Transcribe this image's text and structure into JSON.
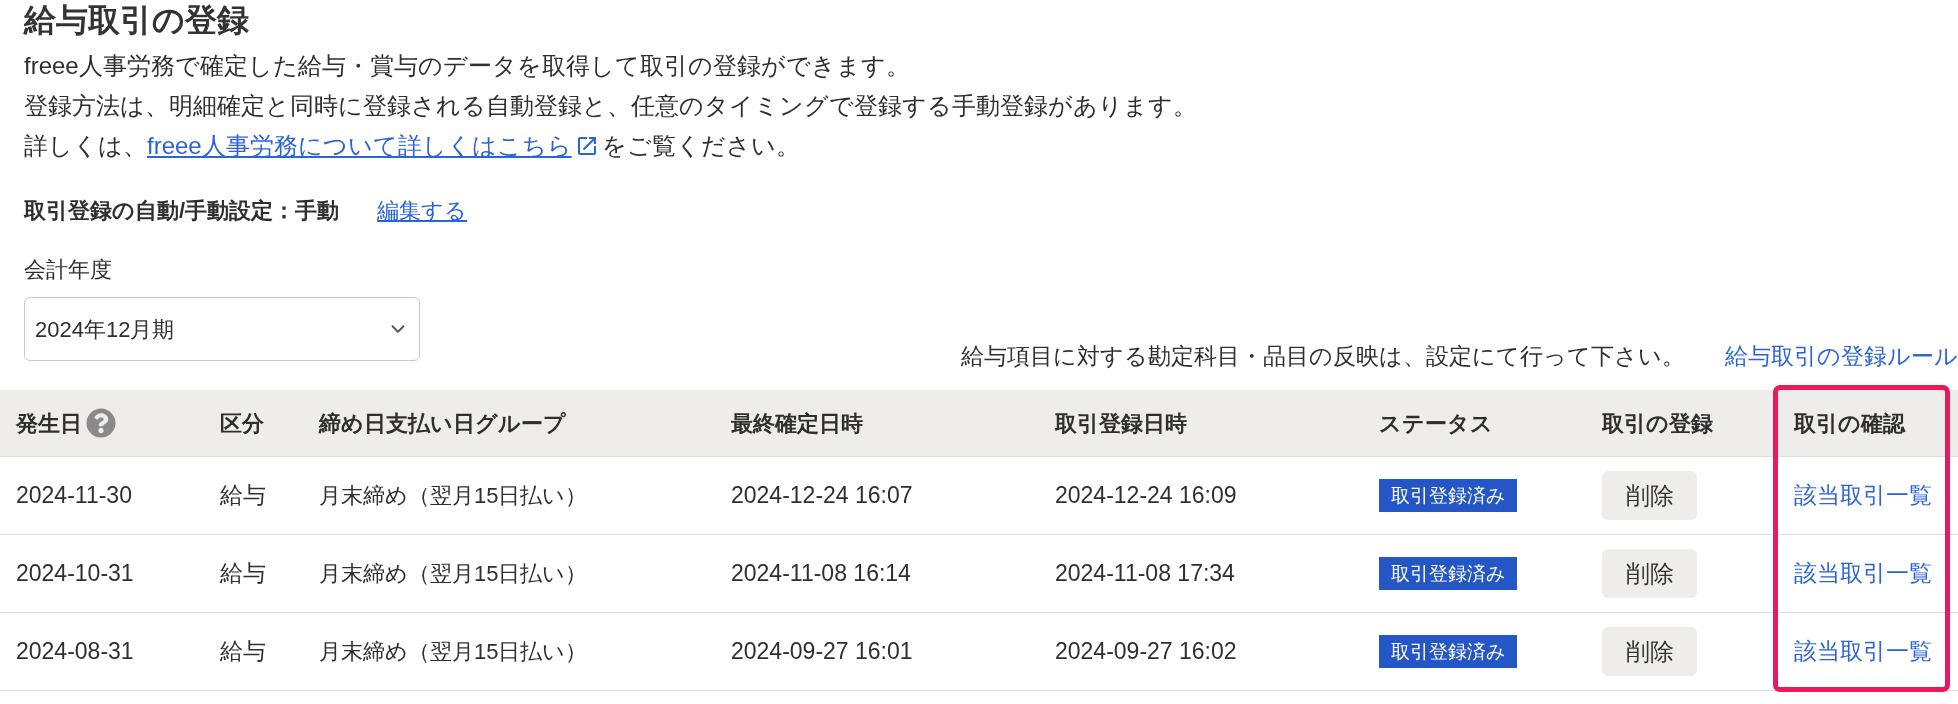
{
  "page": {
    "title": "給与取引の登録"
  },
  "intro": {
    "lines": [
      "freee人事労務で確定した給与・賞与のデータを取得して取引の登録ができます。",
      "登録方法は、明細確定と同時に登録される自動登録と、任意のタイミングで登録する手動登録があります。"
    ],
    "detail": {
      "prefix": "詳しくは、",
      "link": "freee人事労務について詳しくはこちら",
      "suffix": "をご覧ください。"
    }
  },
  "registration_setting": {
    "label": "取引登録の自動/手動設定：手動",
    "edit_link": "編集する"
  },
  "fiscal_year": {
    "label": "会計年度",
    "value": "2024年12月期"
  },
  "notice": {
    "text": "給与項目に対する勘定科目・品目の反映は、設定にて行って下さい。",
    "link": "給与取引の登録ルール"
  },
  "table": {
    "columns": [
      {
        "label": "発生日",
        "help": true,
        "highlighted": false
      },
      {
        "label": "区分",
        "help": false,
        "highlighted": false
      },
      {
        "label": "締め日支払い日グループ",
        "help": false,
        "highlighted": false
      },
      {
        "label": "最終確定日時",
        "help": false,
        "highlighted": false
      },
      {
        "label": "取引登録日時",
        "help": false,
        "highlighted": false
      },
      {
        "label": "ステータス",
        "help": false,
        "highlighted": false
      },
      {
        "label": "取引の登録",
        "help": false,
        "highlighted": false
      },
      {
        "label": "取引の確認",
        "help": false,
        "highlighted": true
      }
    ],
    "rows": [
      {
        "date": "2024-11-30",
        "category": "給与",
        "group": "月末締め（翌月15日払い）",
        "finalized_at": "2024-12-24 16:07",
        "registered_at": "2024-12-24 16:09",
        "status": "取引登録済み",
        "action": "削除",
        "link": "該当取引一覧"
      },
      {
        "date": "2024-10-31",
        "category": "給与",
        "group": "月末締め（翌月15日払い）",
        "finalized_at": "2024-11-08 16:14",
        "registered_at": "2024-11-08 17:34",
        "status": "取引登録済み",
        "action": "削除",
        "link": "該当取引一覧"
      },
      {
        "date": "2024-08-31",
        "category": "給与",
        "group": "月末締め（翌月15日払い）",
        "finalized_at": "2024-09-27 16:01",
        "registered_at": "2024-09-27 16:02",
        "status": "取引登録済み",
        "action": "削除",
        "link": "該当取引一覧"
      }
    ]
  }
}
